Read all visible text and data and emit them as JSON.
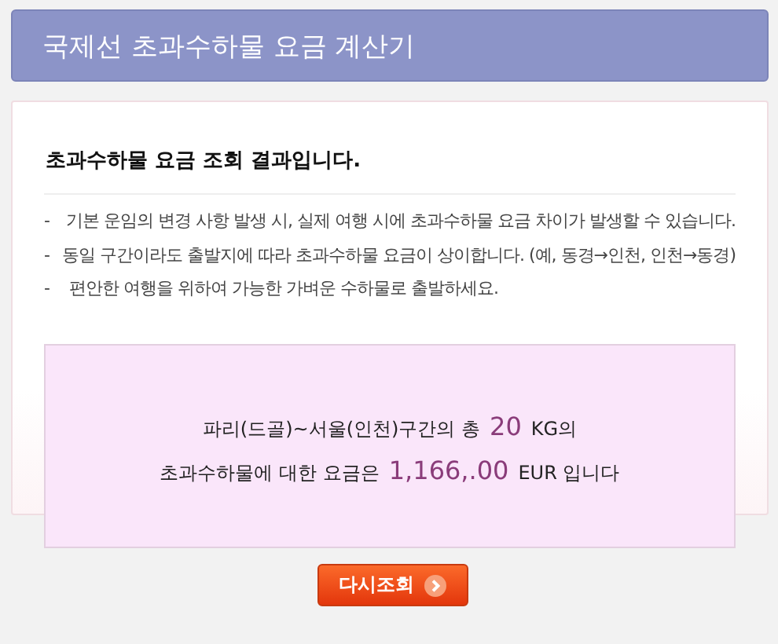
{
  "header": {
    "title": "국제선 초과수하물 요금 계산기"
  },
  "result_heading": "초과수하물 요금 조회 결과입니다.",
  "notes": [
    {
      "bullet": "-",
      "text": "기본 운임의 변경 사항 발생 시, 실제 여행 시에 초과수하물 요금 차이가 발생할 수 있습니다."
    },
    {
      "bullet": "-",
      "text": "동일 구간이라도 출발지에 따라 초과수하물 요금이 상이합니다. (예, 동경→인천, 인천→동경)"
    },
    {
      "bullet": "-",
      "text": "편안한 여행을 위하여 가능한 가벼운 수하물로 출발하세요."
    }
  ],
  "result_lines": [
    {
      "before": "파리(드골)~서울(인천)구간의 총",
      "amount": "20",
      "after": "KG의"
    },
    {
      "before": "초과수하물에 대한 요금은",
      "amount": "1,166,.00",
      "after": "EUR 입니다"
    }
  ],
  "button": {
    "label": "다시조회"
  }
}
